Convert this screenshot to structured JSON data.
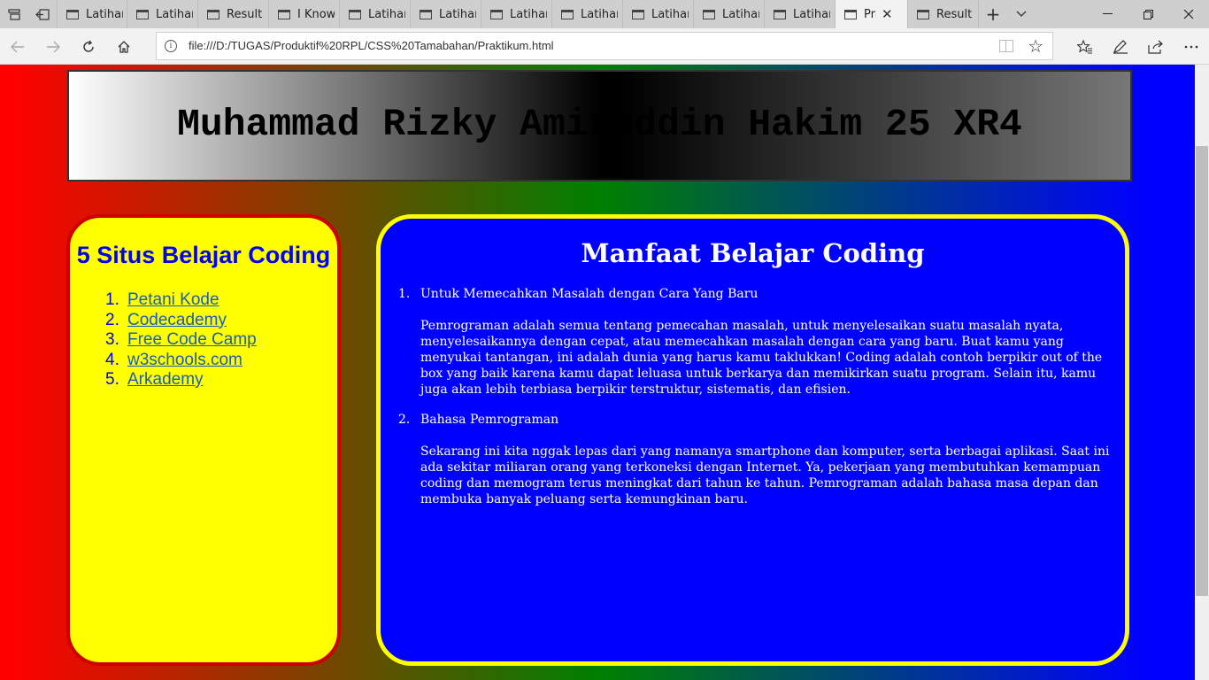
{
  "browser": {
    "tabs": [
      {
        "label": "Latihar",
        "active": false
      },
      {
        "label": "Latihar",
        "active": false
      },
      {
        "label": "Result",
        "active": false
      },
      {
        "label": "I Know",
        "active": false
      },
      {
        "label": "Latihar",
        "active": false
      },
      {
        "label": "Latihar",
        "active": false
      },
      {
        "label": "Latihar",
        "active": false
      },
      {
        "label": "Latihar",
        "active": false
      },
      {
        "label": "Latihar",
        "active": false
      },
      {
        "label": "Latihar",
        "active": false
      },
      {
        "label": "Latihar",
        "active": false
      },
      {
        "label": "Pra",
        "active": true
      },
      {
        "label": "Result",
        "active": false
      }
    ],
    "url": "file:///D:/TUGAS/Produktif%20RPL/CSS%20Tamabahan/Praktikum.html"
  },
  "page": {
    "header_title": "Muhammad Rizky Amiruddin Hakim 25 XR4",
    "sidebar": {
      "title": "5 Situs Belajar Coding",
      "sites": [
        {
          "num": "1.",
          "label": "Petani Kode"
        },
        {
          "num": "2.",
          "label": "Codecademy"
        },
        {
          "num": "3.",
          "label": "Free Code Camp"
        },
        {
          "num": "4.",
          "label": "w3schools.com"
        },
        {
          "num": "5.",
          "label": "Arkademy"
        }
      ]
    },
    "main": {
      "title": "Manfaat Belajar Coding",
      "items": [
        {
          "num": "1.",
          "heading": "Untuk Memecahkan Masalah dengan Cara Yang Baru",
          "text": "Pemrograman adalah semua tentang pemecahan masalah, untuk menyelesaikan suatu masalah nyata, menyelesaikannya dengan cepat, atau memecahkan masalah dengan cara yang baru. Buat kamu yang menyukai tantangan, ini adalah dunia yang harus kamu taklukkan! Coding adalah contoh berpikir out of the box yang baik karena kamu dapat leluasa untuk berkarya dan memikirkan suatu program. Selain itu, kamu juga akan lebih terbiasa berpikir terstruktur, sistematis, dan efisien."
        },
        {
          "num": "2.",
          "heading": "Bahasa Pemrograman",
          "text": "Sekarang ini kita nggak lepas dari yang namanya smartphone dan komputer, serta berbagai aplikasi. Saat ini ada sekitar miliaran orang yang terkoneksi dengan Internet. Ya, pekerjaan yang membutuhkan kemampuan coding dan memogram terus meningkat dari tahun ke tahun. Pemrograman adalah bahasa masa depan dan membuka banyak peluang serta kemungkinan baru."
        }
      ]
    }
  },
  "colors": {
    "sidebar_bg": "#ffff00",
    "sidebar_border": "#cc0000",
    "main_bg": "#0000ff",
    "main_border": "#ffff00",
    "link": "#1a5fb4"
  }
}
